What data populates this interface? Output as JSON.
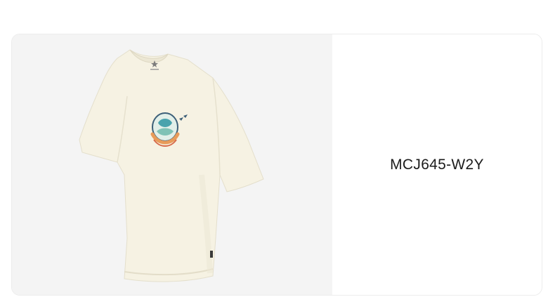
{
  "product": {
    "sku": "MCJ645-W2Y",
    "image_subject": "t-shirt",
    "image_colors": {
      "panel_background": "#f4f4f4",
      "shirt_body": "#f6f2e3",
      "shirt_shadow": "#e9e4d2",
      "graphic_teal": "#49a3ad",
      "graphic_orange": "#e89b5a"
    },
    "icons": [
      "brand-logo-icon",
      "chest-graphic-icon",
      "side-tag-icon"
    ]
  }
}
